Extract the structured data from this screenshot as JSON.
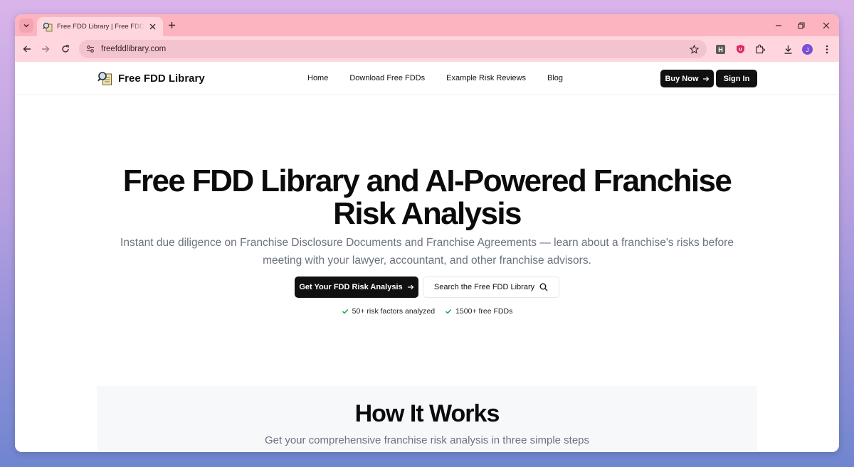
{
  "browser": {
    "tab_title": "Free FDD Library | Free FDD Library",
    "url": "freefddlibrary.com",
    "avatar_initial": "J",
    "ext_h_label": "H"
  },
  "site": {
    "logo_text": "Free FDD Library",
    "nav": [
      "Home",
      "Download Free FDDs",
      "Example Risk Reviews",
      "Blog"
    ],
    "buy_now": "Buy Now",
    "sign_in": "Sign In"
  },
  "hero": {
    "title_line1": "Free FDD Library and AI-Powered Franchise",
    "title_line2": "Risk Analysis",
    "subtitle": "Instant due diligence on Franchise Disclosure Documents and Franchise Agreements — learn about a franchise's risks before meeting with your lawyer, accountant, and other franchise advisors.",
    "cta_primary": "Get Your FDD Risk Analysis",
    "cta_secondary": "Search the Free FDD Library",
    "checks": [
      "50+ risk factors analyzed",
      "1500+ free FDDs"
    ]
  },
  "how_it_works": {
    "title": "How It Works",
    "subtitle": "Get your comprehensive franchise risk analysis in three simple steps"
  },
  "colors": {
    "tab_strip": "#fdb4c1",
    "toolbar": "#ffd6de",
    "dark_button": "#111111",
    "check_green": "#16a34a"
  }
}
